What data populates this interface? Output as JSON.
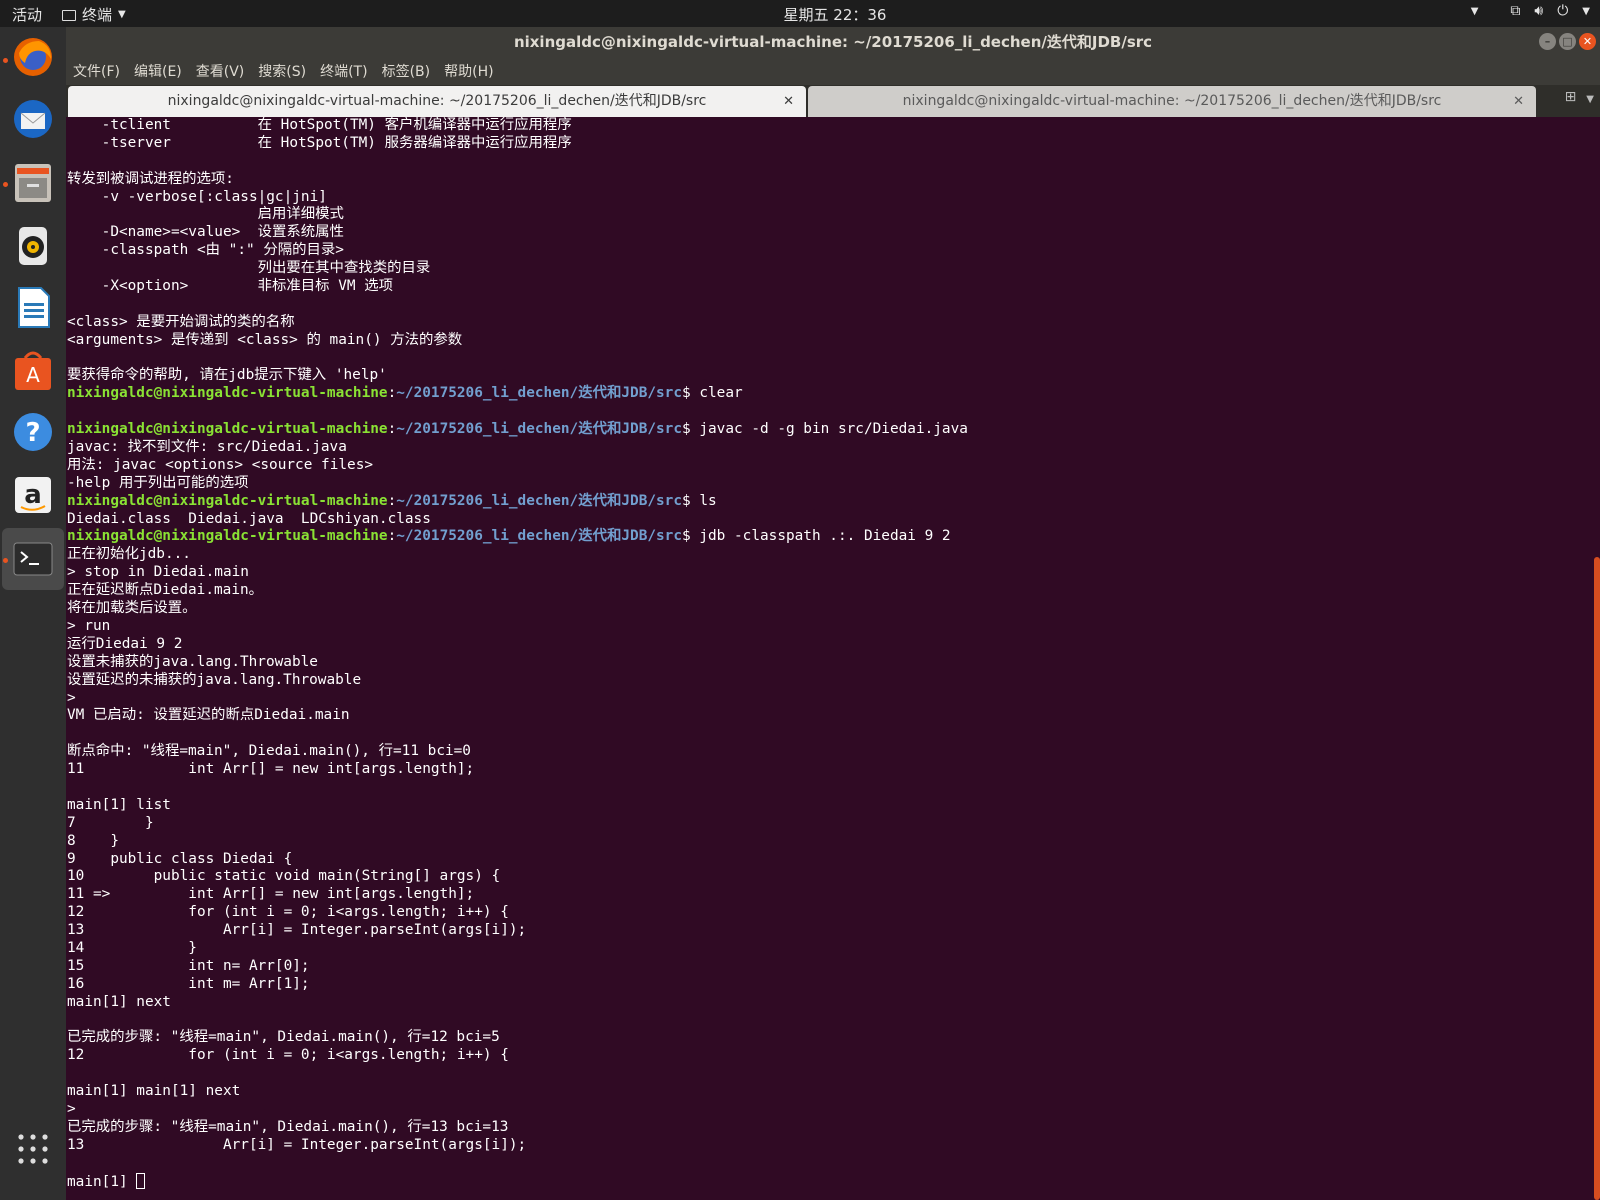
{
  "topbar": {
    "activities": "活动",
    "app_menu": "终端",
    "clock": "星期五 22：36"
  },
  "window": {
    "title": "nixingaldc@nixingaldc-virtual-machine: ~/20175206_li_dechen/迭代和JDB/src"
  },
  "menubar": [
    {
      "label": "文件(F)"
    },
    {
      "label": "编辑(E)"
    },
    {
      "label": "查看(V)"
    },
    {
      "label": "搜索(S)"
    },
    {
      "label": "终端(T)"
    },
    {
      "label": "标签(B)"
    },
    {
      "label": "帮助(H)"
    }
  ],
  "tabs": [
    {
      "label": "nixingaldc@nixingaldc-virtual-machine: ~/20175206_li_dechen/迭代和JDB/src"
    },
    {
      "label": "nixingaldc@nixingaldc-virtual-machine: ~/20175206_li_dechen/迭代和JDB/src"
    }
  ],
  "terminal": {
    "lines": [
      {
        "t": "    -tclient          在 HotSpot(TM) 客户机编译器中运行应用程序"
      },
      {
        "t": "    -tserver          在 HotSpot(TM) 服务器编译器中运行应用程序"
      },
      {
        "t": ""
      },
      {
        "t": "转发到被调试进程的选项:"
      },
      {
        "t": "    -v -verbose[:class|gc|jni]"
      },
      {
        "t": "                      启用详细模式"
      },
      {
        "t": "    -D<name>=<value>  设置系统属性"
      },
      {
        "t": "    -classpath <由 \":\" 分隔的目录>"
      },
      {
        "t": "                      列出要在其中查找类的目录"
      },
      {
        "t": "    -X<option>        非标准目标 VM 选项"
      },
      {
        "t": ""
      },
      {
        "t": "<class> 是要开始调试的类的名称"
      },
      {
        "t": "<arguments> 是传递到 <class> 的 main() 方法的参数"
      },
      {
        "t": ""
      },
      {
        "t": "要获得命令的帮助, 请在jdb提示下键入 'help'"
      },
      {
        "prompt": true,
        "user": "nixingaldc@nixingaldc-virtual-machine",
        "path": "~/20175206_li_dechen/迭代和JDB/src",
        "cmd": "$ clear"
      },
      {
        "t": ""
      },
      {
        "prompt": true,
        "user": "nixingaldc@nixingaldc-virtual-machine",
        "path": "~/20175206_li_dechen/迭代和JDB/src",
        "cmd": "$ javac -d -g bin src/Diedai.java"
      },
      {
        "t": "javac: 找不到文件: src/Diedai.java"
      },
      {
        "t": "用法: javac <options> <source files>"
      },
      {
        "t": "-help 用于列出可能的选项"
      },
      {
        "prompt": true,
        "user": "nixingaldc@nixingaldc-virtual-machine",
        "path": "~/20175206_li_dechen/迭代和JDB/src",
        "cmd": "$ ls"
      },
      {
        "t": "Diedai.class  Diedai.java  LDCshiyan.class"
      },
      {
        "prompt": true,
        "user": "nixingaldc@nixingaldc-virtual-machine",
        "path": "~/20175206_li_dechen/迭代和JDB/src",
        "cmd": "$ jdb -classpath .:. Diedai 9 2"
      },
      {
        "t": "正在初始化jdb..."
      },
      {
        "t": "> stop in Diedai.main"
      },
      {
        "t": "正在延迟断点Diedai.main。"
      },
      {
        "t": "将在加载类后设置。"
      },
      {
        "t": "> run"
      },
      {
        "t": "运行Diedai 9 2"
      },
      {
        "t": "设置未捕获的java.lang.Throwable"
      },
      {
        "t": "设置延迟的未捕获的java.lang.Throwable"
      },
      {
        "t": ">"
      },
      {
        "t": "VM 已启动: 设置延迟的断点Diedai.main"
      },
      {
        "t": ""
      },
      {
        "t": "断点命中: \"线程=main\", Diedai.main(), 行=11 bci=0"
      },
      {
        "t": "11            int Arr[] = new int[args.length];"
      },
      {
        "t": ""
      },
      {
        "t": "main[1] list"
      },
      {
        "t": "7        }"
      },
      {
        "t": "8    }"
      },
      {
        "t": "9    public class Diedai {"
      },
      {
        "t": "10        public static void main(String[] args) {"
      },
      {
        "t": "11 =>         int Arr[] = new int[args.length];"
      },
      {
        "t": "12            for (int i = 0; i<args.length; i++) {"
      },
      {
        "t": "13                Arr[i] = Integer.parseInt(args[i]);"
      },
      {
        "t": "14            }"
      },
      {
        "t": "15            int n= Arr[0];"
      },
      {
        "t": "16            int m= Arr[1];"
      },
      {
        "t": "main[1] next"
      },
      {
        "t": ""
      },
      {
        "t": "已完成的步骤: \"线程=main\", Diedai.main(), 行=12 bci=5"
      },
      {
        "t": "12            for (int i = 0; i<args.length; i++) {"
      },
      {
        "t": ""
      },
      {
        "t": "main[1] main[1] next"
      },
      {
        "t": ">"
      },
      {
        "t": "已完成的步骤: \"线程=main\", Diedai.main(), 行=13 bci=13"
      },
      {
        "t": "13                Arr[i] = Integer.parseInt(args[i]);"
      },
      {
        "t": ""
      },
      {
        "t": "main[1] ",
        "cursor": true
      }
    ]
  }
}
